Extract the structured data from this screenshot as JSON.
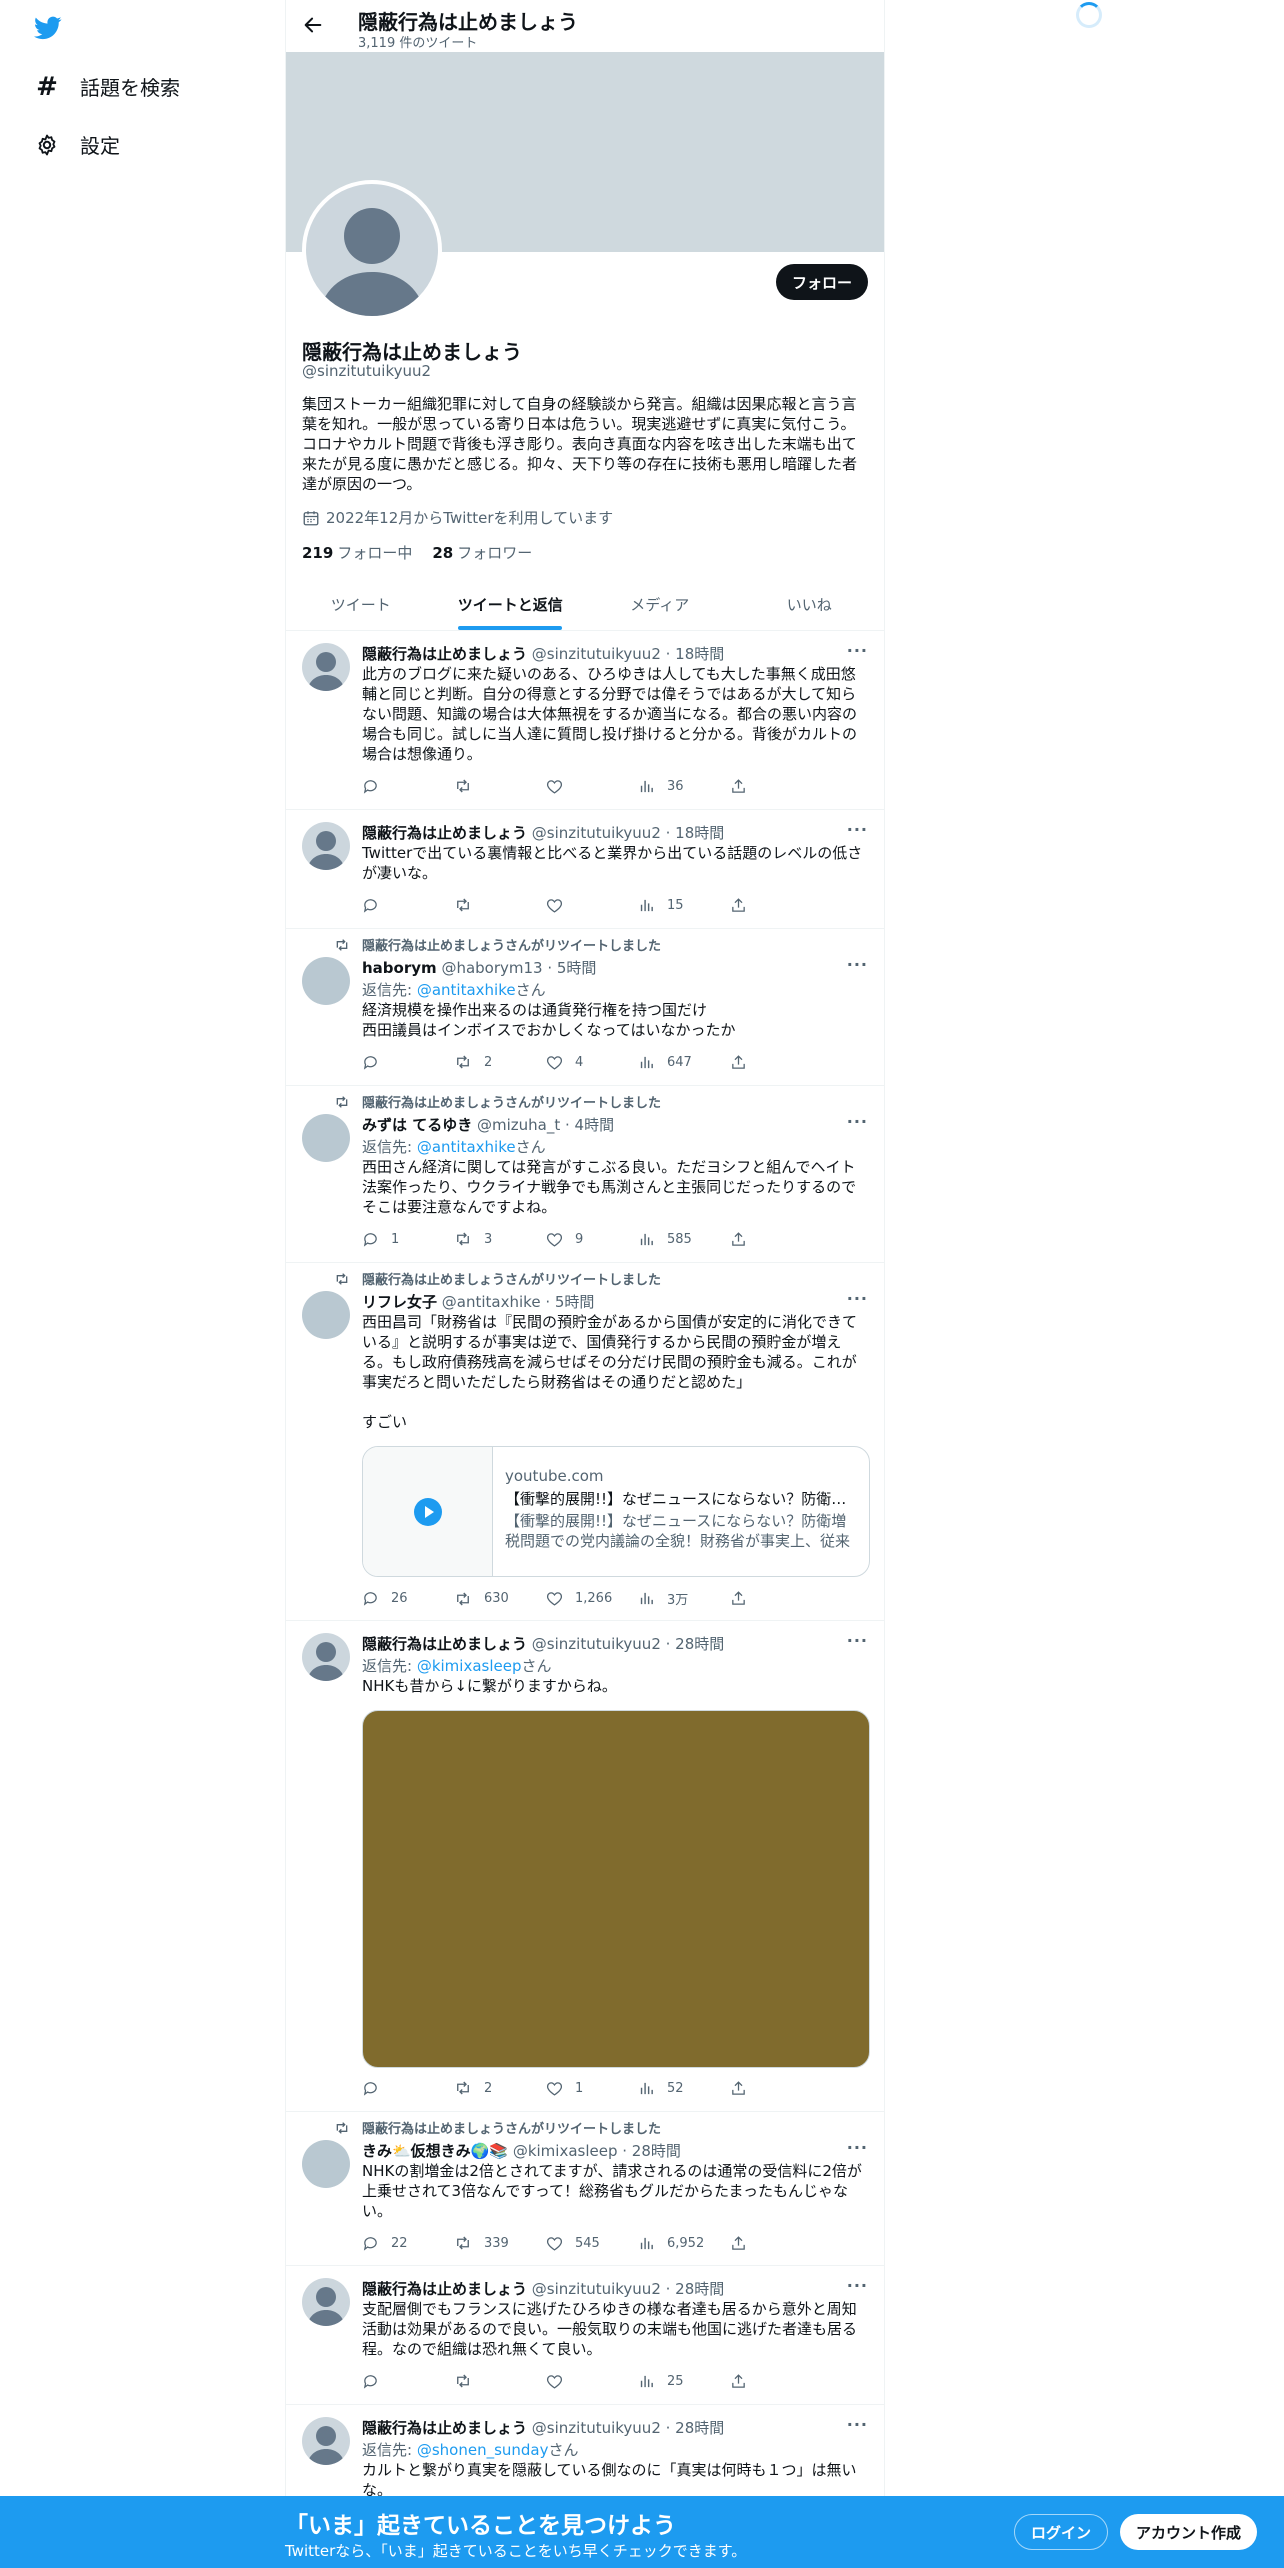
{
  "nav": {
    "explore": "話題を検索",
    "settings": "設定"
  },
  "header": {
    "title": "隠蔽行為は止めましょう",
    "tweet_count": "3,119 件のツイート"
  },
  "profile": {
    "follow_label": "フォロー",
    "name": "隠蔽行為は止めましょう",
    "handle": "@sinzitutuikyuu2",
    "bio": "集団ストーカー組織犯罪に対して自身の経験談から発言。組織は因果応報と言う言葉を知れ。一般が思っている寄り日本は危うい。現実逃避せずに真実に気付こう。コロナやカルト問題で背後も浮き彫り。表向き真面な内容を呟き出した末端も出て来たが見る度に愚かだと感じる。抑々、天下り等の存在に技術も悪用し暗躍した者達が原因の一つ。",
    "joined": "2022年12月からTwitterを利用しています",
    "following_count": "219",
    "following_label": "フォロー中",
    "followers_count": "28",
    "followers_label": "フォロワー"
  },
  "tabs": [
    "ツイート",
    "ツイートと返信",
    "メディア",
    "いいね"
  ],
  "tweets": [
    {
      "name": "隠蔽行為は止めましょう",
      "meta": "@sinzitutuikyuu2 · 18時間",
      "text": "此方のブログに来た疑いのある、ひろゆきは人しても大した事無く成田悠輔と同じと判断。自分の得意とする分野では偉そうではあるが大して知らない問題、知識の場合は大体無視をするか適当になる。都合の悪い内容の場合も同じ。試しに当人達に質問し投げ掛けると分かる。背後がカルトの場合は想像通り。",
      "reply": "",
      "retweet": "",
      "views": "36"
    },
    {
      "name": "隠蔽行為は止めましょう",
      "meta": "@sinzitutuikyuu2 · 18時間",
      "text": "Twitterで出ている裏情報と比べると業界から出ている話題のレベルの低さが凄いな。",
      "reply": "",
      "retweet": "",
      "views": "15"
    },
    {
      "rt_by": "隠蔽行為は止めましょうさんがリツイートしました",
      "name": "haborym",
      "meta": "@haborym13 · 5時間",
      "reply_prefix": "返信先: ",
      "reply_to": "@antitaxhike",
      "reply_suffix": "さん",
      "text": "経済規模を操作出来るのは通貨発行権を持つ国だけ\n西田議員はインボイスでおかしくなってはいなかったか",
      "retweets": "2",
      "likes": "4",
      "views": "647"
    },
    {
      "rt_by": "隠蔽行為は止めましょうさんがリツイートしました",
      "name": "みずは てるゆき",
      "meta": "@mizuha_t · 4時間",
      "reply_prefix": "返信先: ",
      "reply_to": "@antitaxhike",
      "reply_suffix": "さん",
      "text": "西田さん経済に関しては発言がすこぶる良い。ただヨシフと組んでヘイト法案作ったり、ウクライナ戦争でも馬渕さんと主張同じだったりするのでそこは要注意なんですよね。",
      "replies": "1",
      "retweets": "3",
      "likes": "9",
      "views": "585"
    },
    {
      "rt_by": "隠蔽行為は止めましょうさんがリツイートしました",
      "name": "リフレ女子",
      "meta": "@antitaxhike · 5時間",
      "text": "西田昌司「財務省は『民間の預貯金があるから国債が安定的に消化できている』と説明するが事実は逆で、国債発行するから民間の預貯金が増える。もし政府債務残高を減らせばその分だけ民間の預貯金も減る。これが事実だろと問いただしたら財務省はその通りだと認めた」\n\nすごい",
      "card_domain": "youtube.com",
      "card_title": "【衝撃的展開!!】なぜニュースにならない？防衛増税問題での党内議論の全貌！財務省が事実上、従来の説明の誤りを認めた!!",
      "card_desc": "【衝撃的展開!!】なぜニュースにならない？防衛増税問題での党内議論の全貌！財務省が事実上、従来の説明の誤りを認めた",
      "replies": "26",
      "retweets": "630",
      "likes": "1,266",
      "views": "3万"
    },
    {
      "name": "隠蔽行為は止めましょう",
      "meta": "@sinzitutuikyuu2 · 28時間",
      "reply_prefix": "返信先: ",
      "reply_to": "@kimixasleep",
      "reply_suffix": "さん",
      "text": "NHKも昔から↓に繋がりますからね。",
      "media_color": "#806b2d",
      "retweets": "2",
      "likes": "1",
      "views": "52"
    },
    {
      "rt_by": "隠蔽行為は止めましょうさんがリツイートしました",
      "name": "きみ⛅仮想きみ🌍📚",
      "meta": "@kimixasleep · 28時間",
      "text": "NHKの割増金は2倍とされてますが、請求されるのは通常の受信料に2倍が上乗せされて3倍なんですって！総務省もグルだからたまったもんじゃない。",
      "replies": "22",
      "retweets": "339",
      "likes": "545",
      "views": "6,952"
    },
    {
      "name": "隠蔽行為は止めましょう",
      "meta": "@sinzitutuikyuu2 · 28時間",
      "text": "支配層側でもフランスに逃げたひろゆきの様な者達も居るから意外と周知活動は効果があるので良い。一般気取りの末端も他国に逃げた者達も居る程。なので組織は恐れ無くて良い。",
      "views": "25"
    },
    {
      "name": "隠蔽行為は止めましょう",
      "meta": "@sinzitutuikyuu2 · 28時間",
      "reply_prefix": "返信先: ",
      "reply_to": "@shonen_sunday",
      "reply_suffix": "さん",
      "text": "カルトと繋がり真実を隠蔽している側なのに「真実は何時も１つ」は無いな。"
    }
  ],
  "bottom_bar": {
    "title": "「いま」起きていることを見つけよう",
    "subtitle": "Twitterなら、「いま」起きていることをいち早くチェックできます。",
    "login": "ログイン",
    "signup": "アカウント作成"
  },
  "colors": {
    "accent": "#1d9bf0",
    "text": "#0f1419",
    "muted": "#536471"
  }
}
